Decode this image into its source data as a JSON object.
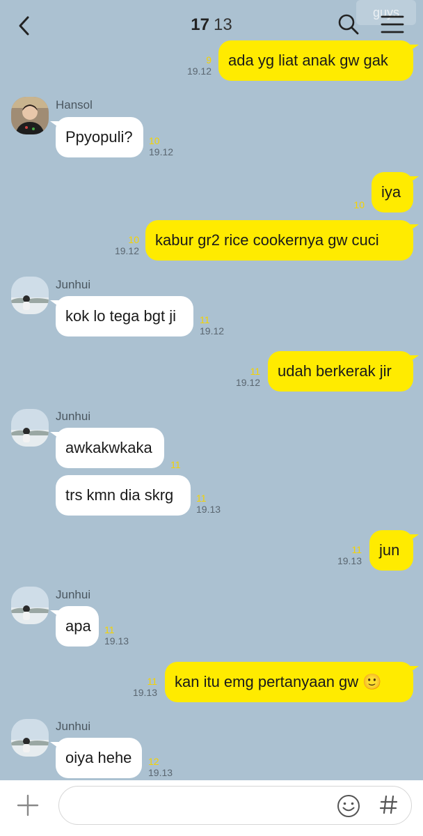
{
  "header": {
    "name": "17",
    "member_count": "13",
    "faded_tag": "guys"
  },
  "messages": [
    {
      "side": "me",
      "text": "ada yg liat anak gw gak",
      "read": "9",
      "time": "19.12"
    },
    {
      "side": "them",
      "sender": "Hansol",
      "text": "Ppyopuli?",
      "read": "10",
      "time": "19.12"
    },
    {
      "side": "me",
      "text": "iya",
      "read": "10",
      "time": ""
    },
    {
      "side": "me",
      "text": "kabur gr2 rice cookernya gw cuci",
      "read": "10",
      "time": "19.12"
    },
    {
      "side": "them",
      "sender": "Junhui",
      "text": "kok lo tega bgt ji",
      "read": "11",
      "time": "19.12"
    },
    {
      "side": "me",
      "text": "udah berkerak jir",
      "read": "11",
      "time": "19.12"
    },
    {
      "side": "them",
      "sender": "Junhui",
      "text": "awkakwkaka",
      "read": "11",
      "time": ""
    },
    {
      "side": "them",
      "text": "trs kmn dia skrg",
      "read": "11",
      "time": "19.13"
    },
    {
      "side": "me",
      "text": "jun",
      "read": "11",
      "time": "19.13"
    },
    {
      "side": "them",
      "sender": "Junhui",
      "text": "apa",
      "read": "11",
      "time": "19.13"
    },
    {
      "side": "me",
      "text": "kan itu emg pertanyaan gw 🙂",
      "read": "11",
      "time": "19.13"
    },
    {
      "side": "them",
      "sender": "Junhui",
      "text": "oiya hehe",
      "read": "12",
      "time": "19.13"
    }
  ],
  "input": {
    "placeholder": ""
  },
  "colors": {
    "background": "#abc1d1",
    "my_bubble": "#ffeb00",
    "their_bubble": "#ffffff",
    "read_count": "#f5d300"
  },
  "icons": {
    "back": "chevron-left-icon",
    "search": "search-icon",
    "menu": "hamburger-menu-icon",
    "plus": "plus-icon",
    "emoji": "smiley-icon",
    "hash": "hash-icon"
  }
}
